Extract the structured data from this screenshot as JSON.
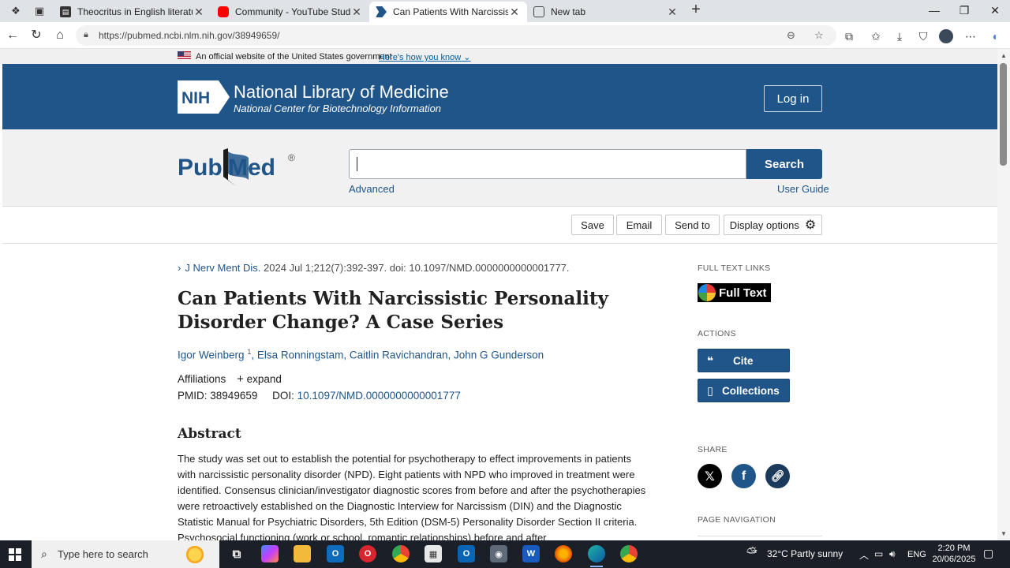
{
  "browser": {
    "tabs": [
      {
        "title": "Theocritus in English literature : K",
        "favicon": "book-icon"
      },
      {
        "title": "Community - YouTube Studio",
        "favicon": "youtube-icon"
      },
      {
        "title": "Can Patients With Narcissistic Per",
        "favicon": "pubmed-icon"
      },
      {
        "title": "New tab",
        "favicon": "newtab-icon"
      }
    ],
    "url": "https://pubmed.ncbi.nlm.nih.gov/38949659/"
  },
  "gov_banner": {
    "text": "An official website of the United States government",
    "link": "Here's how you know"
  },
  "header": {
    "nih_logo": "NIH",
    "title": "National Library of Medicine",
    "subtitle": "National Center for Biotechnology Information",
    "login": "Log in"
  },
  "search": {
    "logo_pub": "Pub",
    "logo_med": "Med",
    "logo_reg": "®",
    "button": "Search",
    "advanced": "Advanced",
    "user_guide": "User Guide"
  },
  "toolbar": {
    "save": "Save",
    "email": "Email",
    "send_to": "Send to",
    "display_options": "Display options"
  },
  "article": {
    "journal": "J Nerv Ment Dis.",
    "citation": "2024 Jul 1;212(7):392-397. doi: 10.1097/NMD.0000000000001777.",
    "title": "Can Patients With Narcissistic Personality Disorder Change? A Case Series",
    "authors": [
      {
        "name": "Igor Weinberg",
        "sup": "1"
      },
      {
        "name": "Elsa Ronningstam",
        "sup": ""
      },
      {
        "name": "Caitlin Ravichandran",
        "sup": ""
      },
      {
        "name": "John G Gunderson",
        "sup": ""
      }
    ],
    "affiliations_label": "Affiliations",
    "expand_label": "expand",
    "pmid_label": "PMID:",
    "pmid": "38949659",
    "doi_label": "DOI:",
    "doi": "10.1097/NMD.0000000000001777",
    "abstract_heading": "Abstract",
    "abstract_text": "The study was set out to establish the potential for psychotherapy to effect improvements in patients with narcissistic personality disorder (NPD). Eight patients with NPD who improved in treatment were identified. Consensus clinician/investigator diagnostic scores from before and after the psychotherapies were retroactively established on the Diagnostic Interview for Narcissism (DIN) and the Diagnostic Statistic Manual for Psychiatric Disorders, 5th Edition (DSM-5) Personality Disorder Section II criteria. Psychosocial functioning (work or school, romantic relationships) before and after"
  },
  "sidebar": {
    "full_text_links": "FULL TEXT LINKS",
    "full_text_button": "Full Text",
    "actions": "ACTIONS",
    "cite": "Cite",
    "collections": "Collections",
    "share": "SHARE",
    "page_navigation": "PAGE NAVIGATION"
  },
  "taskbar": {
    "search_placeholder": "Type here to search",
    "weather": "32°C  Partly sunny",
    "language": "ENG",
    "time": "2:20 PM",
    "date": "20/06/2025"
  },
  "colors": {
    "nih_blue": "#20558a",
    "banner_gray": "#f0f0f0",
    "taskbar": "#1b1f27"
  }
}
